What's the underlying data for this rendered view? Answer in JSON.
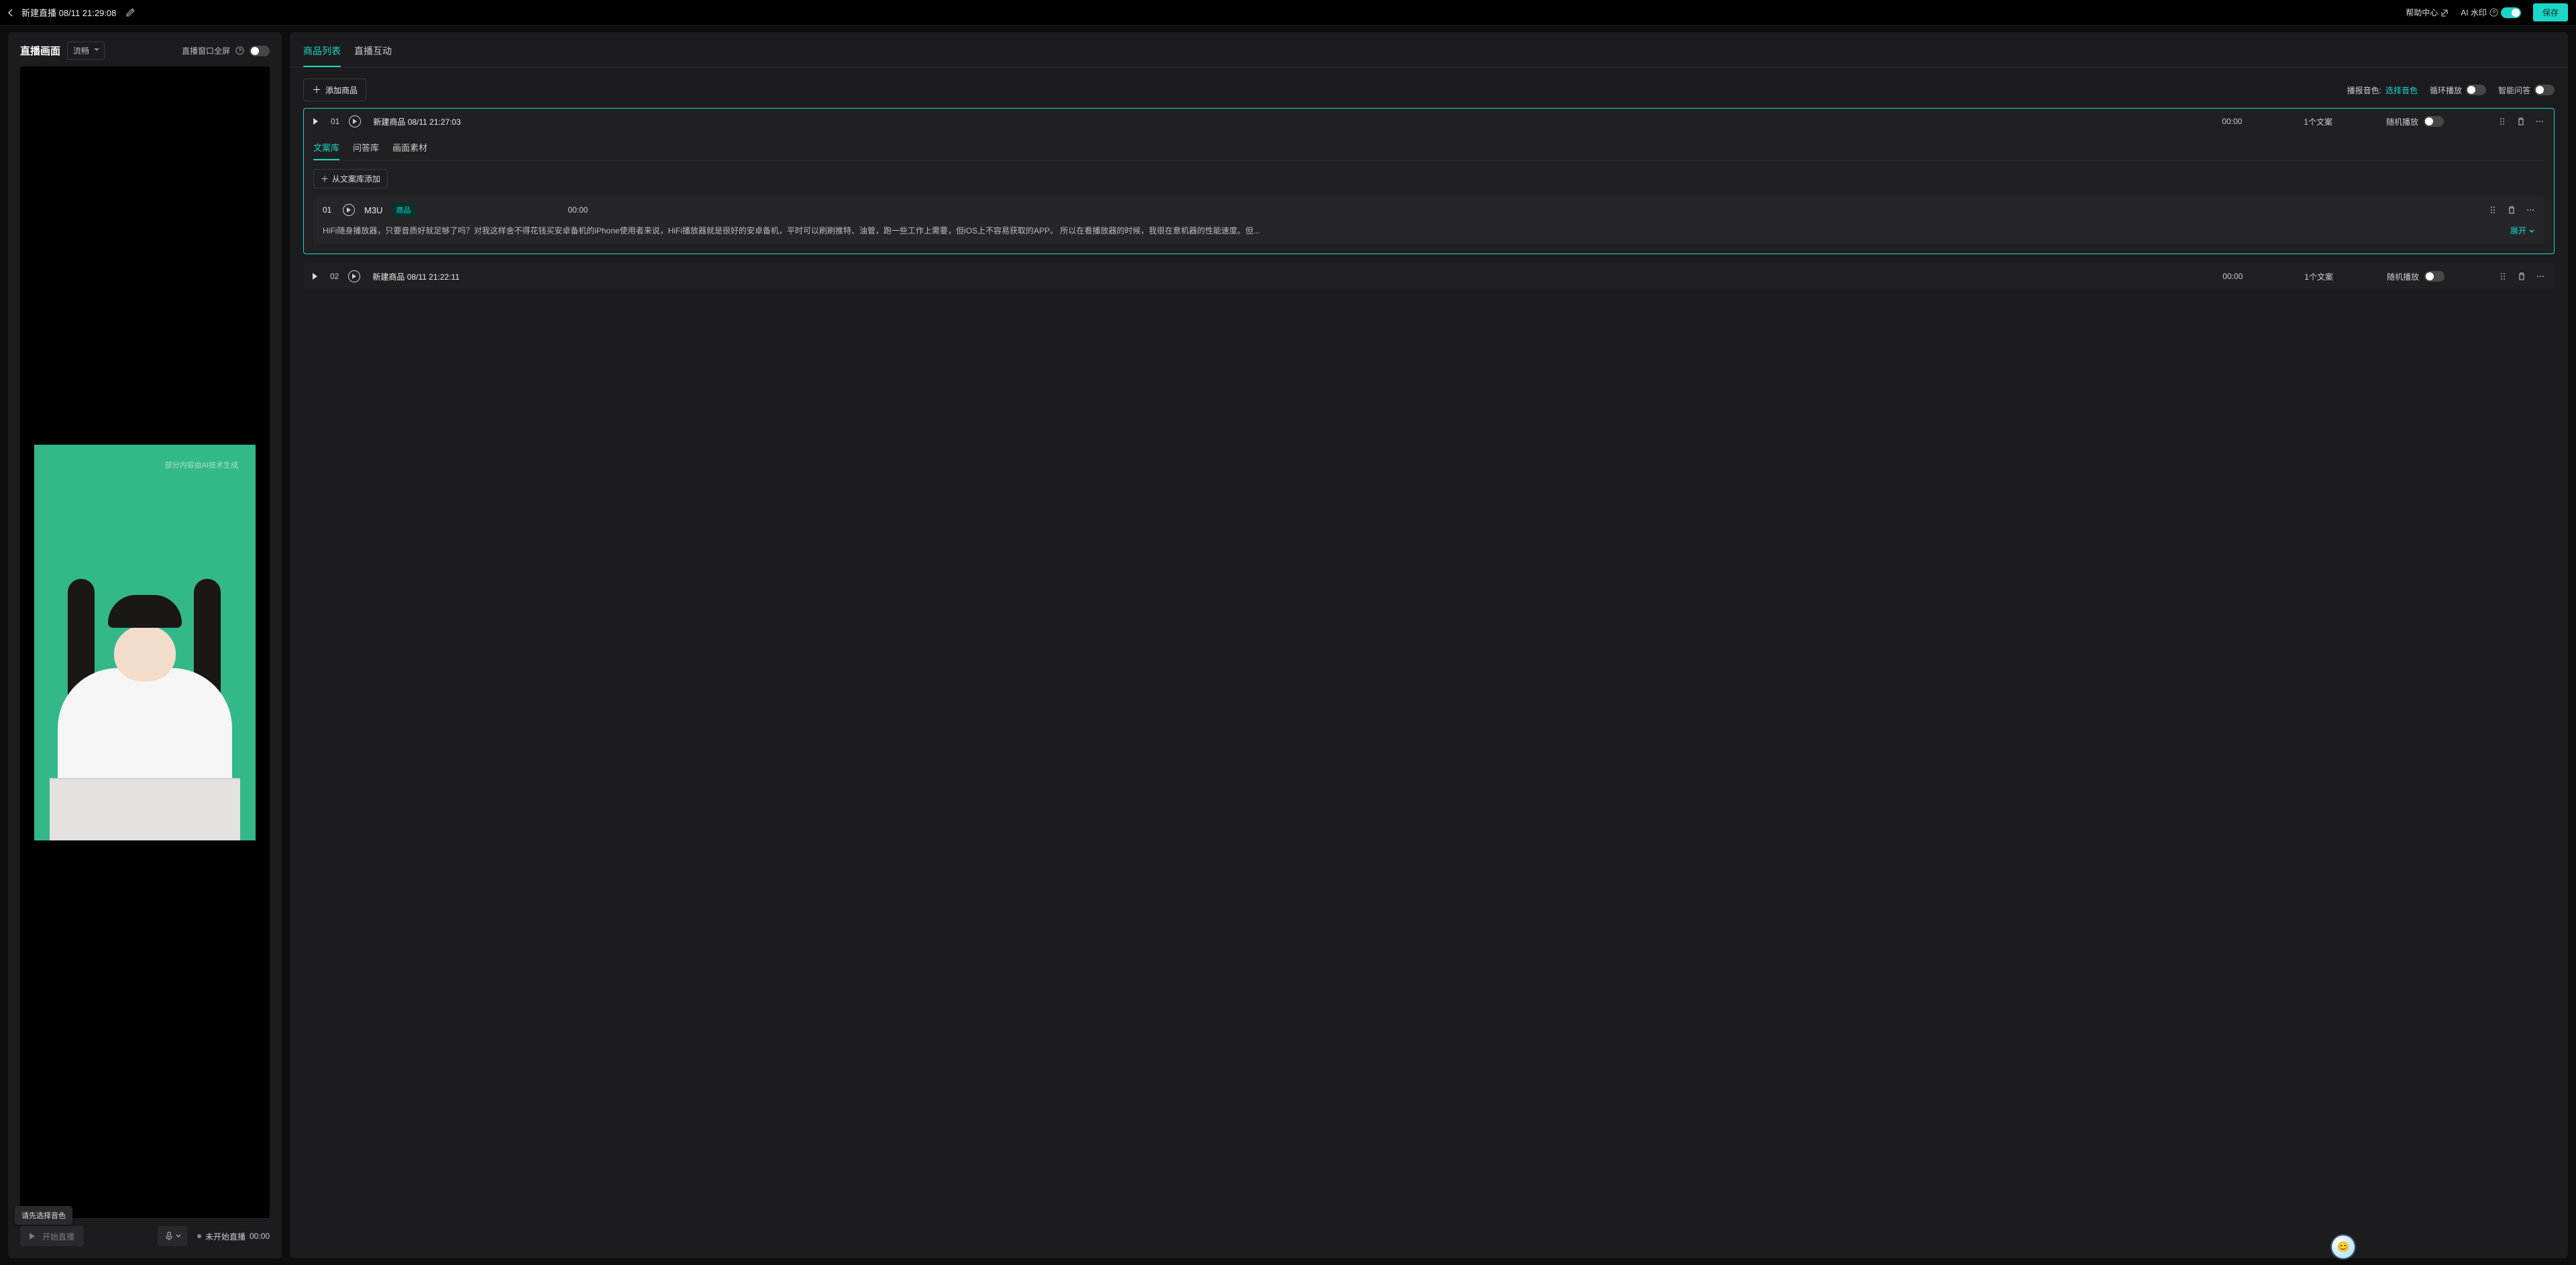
{
  "header": {
    "title": "新建直播 08/11 21:29:08",
    "help_label": "帮助中心",
    "watermark_label": "AI 水印",
    "watermark_on": true,
    "save_label": "保存"
  },
  "left_panel": {
    "title": "直播画面",
    "quality_select": "流畅",
    "fullscreen_label": "直播窗口全屏",
    "fullscreen_on": false,
    "ai_note": "部分内容由AI技术生成",
    "voice_tooltip": "请先选择音色",
    "start_btn": "开始直播",
    "status_text": "未开始直播",
    "status_time": "00:00"
  },
  "right_panel": {
    "tabs": [
      {
        "label": "商品列表",
        "active": true
      },
      {
        "label": "直播互动",
        "active": false
      }
    ],
    "toolbar": {
      "add_product": "添加商品",
      "voice_label": "播报音色:",
      "voice_action": "选择音色",
      "loop_label": "循环播放",
      "loop_on": false,
      "smartqa_label": "智能问答",
      "smartqa_on": false
    },
    "products": [
      {
        "index": "01",
        "name": "新建商品 08/11 21:27:03",
        "duration": "00:00",
        "script_count": "1个文案",
        "random_label": "随机播放",
        "random_on": false,
        "expanded": true,
        "sub_tabs": [
          {
            "label": "文案库",
            "active": true
          },
          {
            "label": "问答库",
            "active": false
          },
          {
            "label": "画面素材",
            "active": false
          }
        ],
        "import_label": "从文案库添加",
        "scripts": [
          {
            "index": "01",
            "title": "M3U",
            "tag": "商品",
            "duration": "00:00",
            "text": "HiFi随身播放器，只要音质好就足够了吗？对我这样舍不得花钱买安卓备机的iPhone使用者来说，HiFi播放器就是很好的安卓备机，平时可以刷刷推特、油管，跑一些工作上需要，但iOS上不容易获取的APP。 所以在看播放器的时候，我很在意机器的性能速度。但...",
            "expand_label": "展开"
          }
        ]
      },
      {
        "index": "02",
        "name": "新建商品 08/11 21:22:11",
        "duration": "00:00",
        "script_count": "1个文案",
        "random_label": "随机播放",
        "random_on": false,
        "expanded": false
      }
    ]
  },
  "chat_face": "😊"
}
